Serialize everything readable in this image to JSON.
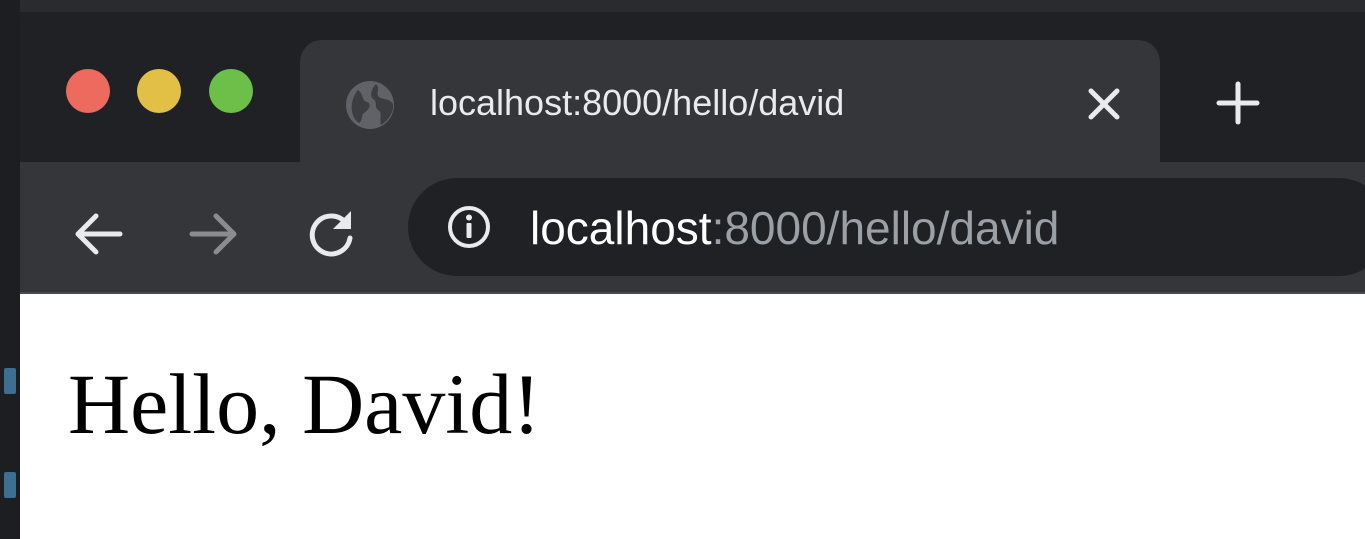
{
  "browser": {
    "tab": {
      "title": "localhost:8000/hello/david",
      "favicon": "globe-icon",
      "close_icon": "close-icon"
    },
    "new_tab_icon": "plus-icon",
    "toolbar": {
      "back_icon": "arrow-left-icon",
      "forward_icon": "arrow-right-icon",
      "reload_icon": "reload-icon"
    },
    "omnibox": {
      "info_icon": "info-icon",
      "host": "localhost",
      "path": ":8000/hello/david"
    },
    "colors": {
      "close": "#ed6a5e",
      "minimize": "#e2bf45",
      "maximize": "#6cc04a",
      "frame": "#202124",
      "toolbar": "#35363a"
    }
  },
  "page": {
    "greeting": "Hello, David!"
  }
}
